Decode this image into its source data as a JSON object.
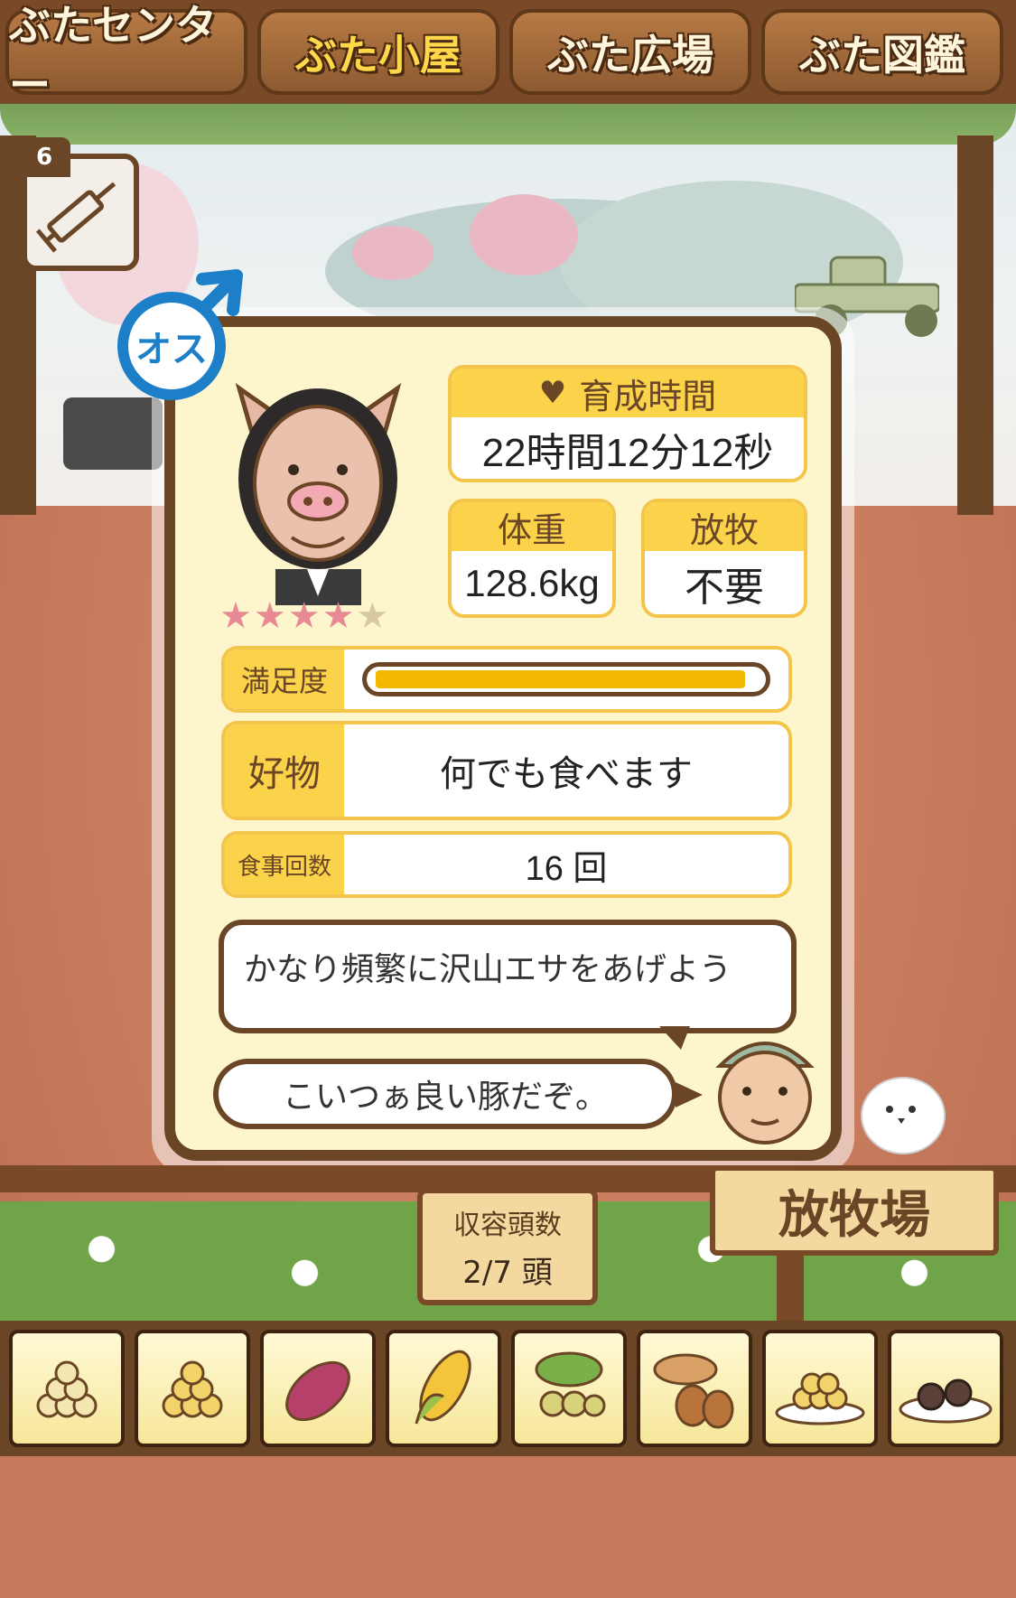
{
  "tabs": [
    {
      "label": "ぶたセンター",
      "active": false
    },
    {
      "label": "ぶた小屋",
      "active": true
    },
    {
      "label": "ぶた広場",
      "active": false
    },
    {
      "label": "ぶた図鑑",
      "active": false
    }
  ],
  "item": {
    "count": "6",
    "icon": "syringe-icon"
  },
  "pig": {
    "gender_label": "オス",
    "gender_icon": "male-symbol-icon",
    "stars_filled": 4,
    "stars_total": 5
  },
  "stats": {
    "growth_time_label": "育成時間",
    "growth_time_value": "22時間12分12秒",
    "weight_label": "体重",
    "weight_value": "128.6kg",
    "grazing_label": "放牧",
    "grazing_value": "不要",
    "satisfaction_label": "満足度",
    "satisfaction_level": 0.97,
    "favorite_label": "好物",
    "favorite_value": "何でも食べます",
    "meals_label": "食事回数",
    "meals_value": "16 回"
  },
  "advice": "かなり頻繁に沢山エサをあげよう",
  "farmer_comment": "こいつぁ良い豚だぞ。",
  "capacity": {
    "label": "収容頭数",
    "value": "2/7 頭"
  },
  "pasture_sign": "放牧場",
  "foods": [
    "grain-icon",
    "grain-icon",
    "sweet-potato-icon",
    "corn-icon",
    "soybean-icon",
    "acorn-icon",
    "grain-plate-icon",
    "meat-dish-icon"
  ],
  "colors": {
    "accent_yellow": "#fbd34a",
    "frame_brown": "#6a4526",
    "gauge": "#f5b800",
    "star": "#e88a95"
  }
}
